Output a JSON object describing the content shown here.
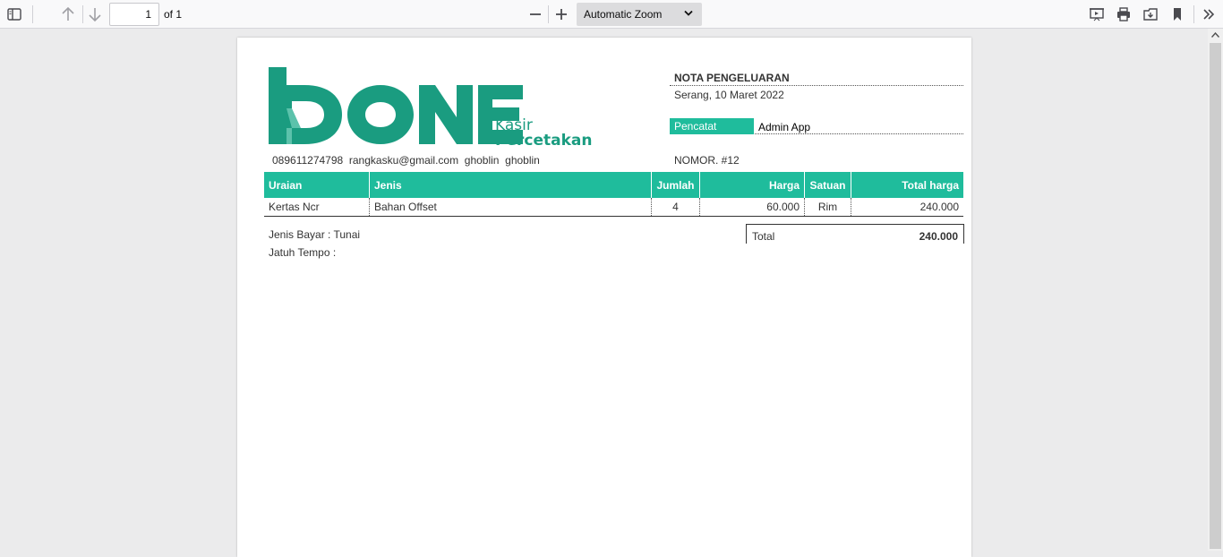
{
  "toolbar": {
    "page_number": "1",
    "page_of": "of 1",
    "zoom": "Automatic Zoom"
  },
  "logo": {
    "brand": "DONE",
    "line1": "Kasir",
    "line2": "Percetakan",
    "color": "#1a9c80"
  },
  "contact": {
    "phone": "089611274798",
    "email": "rangkasku@gmail.com",
    "name1": "ghoblin",
    "name2": "ghoblin"
  },
  "nota": {
    "title": "NOTA PENGELUARAN",
    "date": "Serang, 10 Maret 2022",
    "pencatat_label": "Pencatat",
    "pencatat_value": "Admin App",
    "nomor": "NOMOR. #12"
  },
  "table": {
    "headers": [
      "Uraian",
      "Jenis",
      "Jumlah",
      "Harga",
      "Satuan",
      "Total harga"
    ],
    "rows": [
      [
        "Kertas Ncr",
        "Bahan Offset",
        "4",
        "60.000",
        "Rim",
        "240.000"
      ]
    ]
  },
  "footer": {
    "jenis_bayar": "Jenis Bayar : Tunai",
    "jatuh_tempo": "Jatuh Tempo :",
    "total_label": "Total",
    "total_value": "240.000"
  },
  "colors": {
    "accent": "#1fbc9c"
  }
}
